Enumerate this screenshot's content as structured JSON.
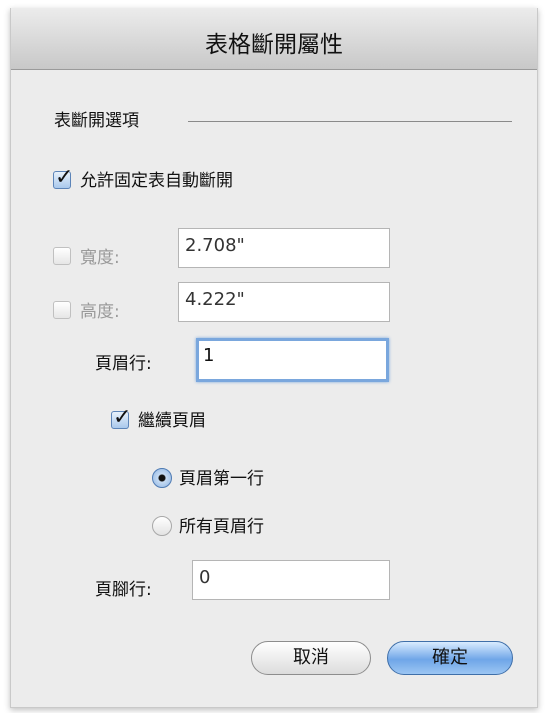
{
  "dialog": {
    "title": "表格斷開屬性"
  },
  "section": {
    "label": "表斷開選項"
  },
  "allow_break": {
    "label": "允許固定表自動斷開",
    "checked": true
  },
  "width": {
    "label": "寬度:",
    "value": "2.708\"",
    "checked": false
  },
  "height": {
    "label": "高度:",
    "value": "4.222\"",
    "checked": false
  },
  "header_rows": {
    "label": "頁眉行:",
    "value": "1"
  },
  "continued_header": {
    "label": "繼續頁眉",
    "checked": true
  },
  "radio_first": {
    "label": "頁眉第一行",
    "selected": true
  },
  "radio_all": {
    "label": "所有頁眉行",
    "selected": false
  },
  "footer_rows": {
    "label": "頁腳行:",
    "value": "0"
  },
  "buttons": {
    "cancel": "取消",
    "ok": "確定"
  }
}
